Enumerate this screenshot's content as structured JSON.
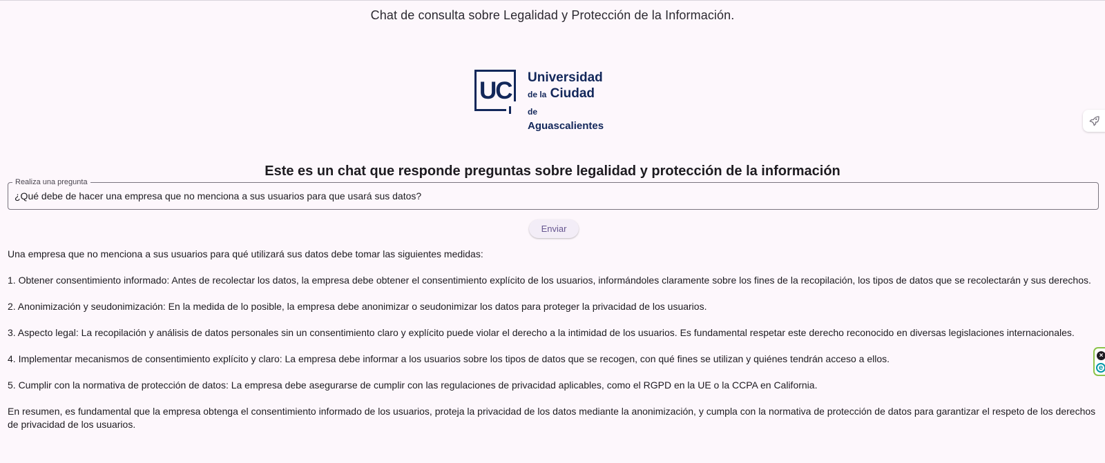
{
  "app": {
    "title": "Chat de consulta sobre Legalidad y Protección de la Información."
  },
  "logo": {
    "mark": "UC",
    "line1": "Universidad",
    "line2_prefix": "de la",
    "line2_main": "Ciudad",
    "line2_suffix": "de",
    "line3": "Aguascalientes",
    "color": "#12275a"
  },
  "main": {
    "heading": "Este es un chat que responde preguntas sobre legalidad y protección de la información",
    "question_field": {
      "label": "Realiza una pregunta",
      "value": "¿Qué debe de hacer una empresa que no menciona a sus usuarios para que usará sus datos?"
    },
    "send_label": "Enviar",
    "answer": [
      "Una empresa que no menciona a sus usuarios para qué utilizará sus datos debe tomar las siguientes medidas:",
      "1. Obtener consentimiento informado: Antes de recolectar los datos, la empresa debe obtener el consentimiento explícito de los usuarios, informándoles claramente sobre los fines de la recopilación, los tipos de datos que se recolectarán y sus derechos.",
      "2. Anonimización y seudonimización: En la medida de lo posible, la empresa debe anonimizar o seudonimizar los datos para proteger la privacidad de los usuarios.",
      "3. Aspecto legal: La recopilación y análisis de datos personales sin un consentimiento claro y explícito puede violar el derecho a la intimidad de los usuarios. Es fundamental respetar este derecho reconocido en diversas legislaciones internacionales.",
      "4. Implementar mecanismos de consentimiento explícito y claro: La empresa debe informar a los usuarios sobre los tipos de datos que se recogen, con qué fines se utilizan y quiénes tendrán acceso a ellos.",
      "5. Cumplir con la normativa de protección de datos: La empresa debe asegurarse de cumplir con las regulaciones de privacidad aplicables, como el RGPD en la UE o la CCPA en California.",
      "En resumen, es fundamental que la empresa obtenga el consentimiento informado de los usuarios, proteja la privacidad de los datos mediante la anonimización, y cumpla con la normativa de protección de datos para garantizar el respeto de los derechos de privacidad de los usuarios."
    ]
  },
  "side": {
    "rocket_icon": "rocket-icon",
    "widget_close_icon": "close-circle-icon",
    "widget_e_icon": "e-circle-icon",
    "widget_border_color": "#8bc34a"
  },
  "colors": {
    "background": "#fdf7fc",
    "button_bg": "#f3edf7",
    "button_text": "#65558f",
    "field_border": "#79747e"
  }
}
